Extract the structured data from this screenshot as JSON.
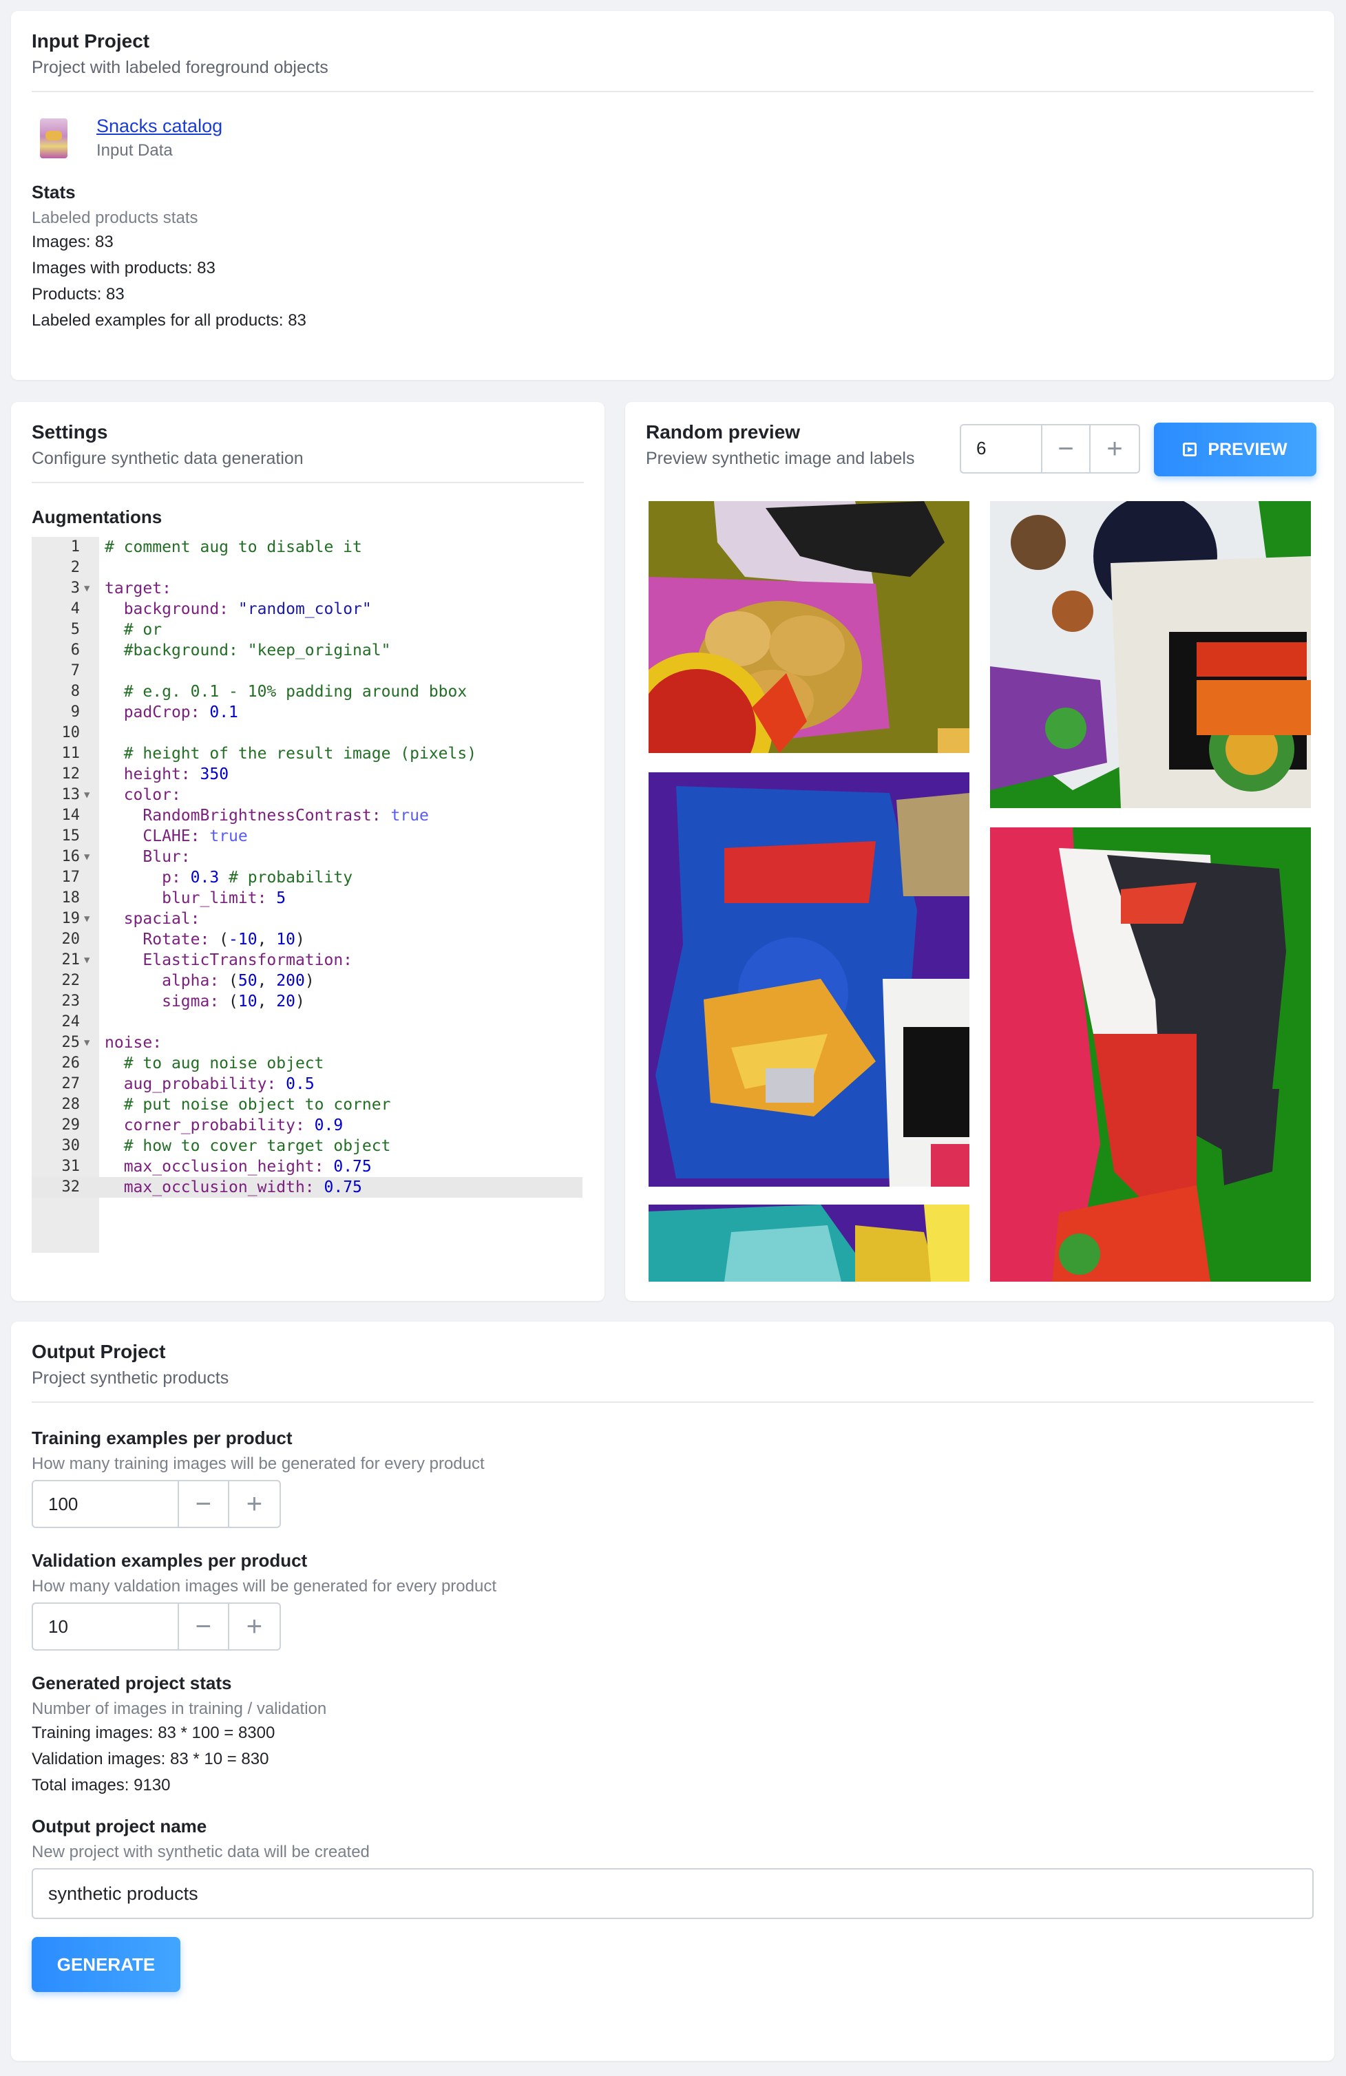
{
  "input_project": {
    "title": "Input Project",
    "subtitle": "Project with labeled foreground objects",
    "project_name": "Snacks catalog",
    "project_type": "Input Data",
    "stats_title": "Stats",
    "stats_subtitle": "Labeled products stats",
    "stats": [
      "Images: 83",
      "Images with products: 83",
      "Products: 83",
      "Labeled examples for all products: 83"
    ]
  },
  "settings": {
    "title": "Settings",
    "subtitle": "Configure synthetic data generation",
    "augmentations_title": "Augmentations",
    "code_lines": [
      "# comment aug to disable it",
      "",
      "target:",
      "  background: \"random_color\"",
      "  # or",
      "  #background: \"keep_original\"",
      "",
      "  # e.g. 0.1 - 10% padding around bbox",
      "  padCrop: 0.1",
      "",
      "  # height of the result image (pixels)",
      "  height: 350",
      "  color:",
      "    RandomBrightnessContrast: true",
      "    CLAHE: true",
      "    Blur:",
      "      p: 0.3 # probability",
      "      blur_limit: 5",
      "  spacial:",
      "    Rotate: (-10, 10)",
      "    ElasticTransformation:",
      "      alpha: (50, 200)",
      "      sigma: (10, 20)",
      "",
      "noise:",
      "  # to aug noise object",
      "  aug_probability: 0.5",
      "  # put noise object to corner",
      "  corner_probability: 0.9",
      "  # how to cover target object",
      "  max_occlusion_height: 0.75",
      "  max_occlusion_width: 0.75"
    ]
  },
  "random_preview": {
    "title": "Random preview",
    "subtitle": "Preview synthetic image and labels",
    "count": "6",
    "button_label": "PREVIEW"
  },
  "output_project": {
    "title": "Output Project",
    "subtitle": "Project synthetic products",
    "training_title": "Training examples per product",
    "training_subtitle": "How many training images will be generated for every product",
    "training_value": "100",
    "validation_title": "Validation examples per product",
    "validation_subtitle": "How many valdation images will be generated for every product",
    "validation_value": "10",
    "gen_stats_title": "Generated project stats",
    "gen_stats_subtitle": "Number of images in training / validation",
    "gen_stats": [
      "Training images: 83 * 100 = 8300",
      "Validation images: 83 * 10 = 830",
      "Total images: 9130"
    ],
    "name_title": "Output project name",
    "name_subtitle": "New project with synthetic data will be created",
    "name_value": "synthetic products",
    "generate_label": "GENERATE"
  },
  "colors": {
    "accent": "#2b8cff",
    "link": "#1a3cd6",
    "background": "#f0f2f5"
  }
}
